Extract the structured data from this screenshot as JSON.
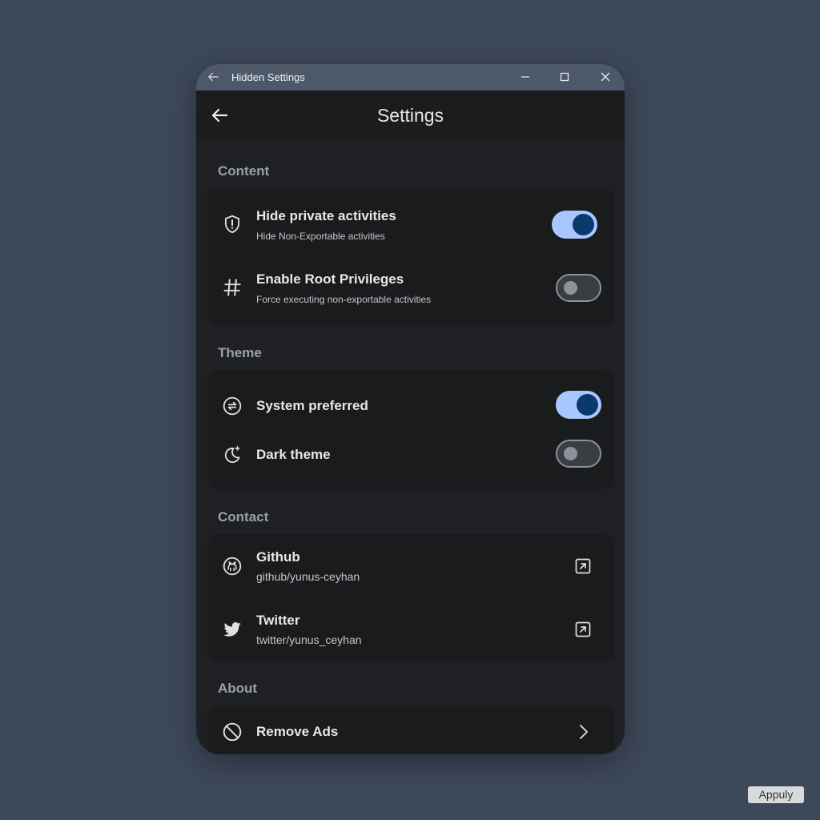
{
  "window": {
    "title": "Hidden Settings"
  },
  "appbar": {
    "title": "Settings"
  },
  "sections": {
    "content": {
      "title": "Content",
      "items": [
        {
          "title": "Hide private activities",
          "subtitle": "Hide Non-Exportable activities",
          "icon": "shield-alert-icon",
          "toggle": true
        },
        {
          "title": "Enable Root Privileges",
          "subtitle": "Force executing non-exportable activities",
          "icon": "hash-icon",
          "toggle": false
        }
      ]
    },
    "theme": {
      "title": "Theme",
      "items": [
        {
          "title": "System preferred",
          "icon": "sync-theme-icon",
          "toggle": true
        },
        {
          "title": "Dark theme",
          "icon": "moon-star-icon",
          "toggle": false
        }
      ]
    },
    "contact": {
      "title": "Contact",
      "items": [
        {
          "title": "Github",
          "subtitle": "github/yunus-ceyhan",
          "icon": "github-icon",
          "trailing": "open-external-icon"
        },
        {
          "title": "Twitter",
          "subtitle": "twitter/yunus_ceyhan",
          "icon": "twitter-icon",
          "trailing": "open-external-icon"
        }
      ]
    },
    "about": {
      "title": "About",
      "items": [
        {
          "title": "Remove Ads",
          "icon": "block-icon",
          "trailing": "chevron-right-icon"
        }
      ]
    }
  },
  "overlay": {
    "apply_label": "Appuly"
  },
  "colors": {
    "background": "#3d4859",
    "titlebar": "#4d5868",
    "window": "#1e2023",
    "card": "#1a1b1d",
    "toggle_on_track": "#a9c7ff",
    "toggle_on_knob": "#0a3a6b",
    "toggle_off_track": "#3a3d42",
    "toggle_off_outline": "#8d9199"
  }
}
